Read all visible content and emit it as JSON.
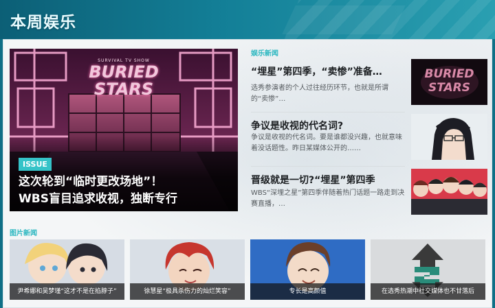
{
  "header": {
    "title": "本周娱乐"
  },
  "feature": {
    "badge": "ISSUE",
    "headline_line1": "这次轮到“临时更改场地”！",
    "headline_line2": "WBS盲目追求收视，独断专行",
    "logo_line1": "BURIED",
    "logo_line2": "STARS",
    "logo_small": "SURVIVAL TV SHOW"
  },
  "sections": {
    "news": "娱乐新闻",
    "photos": "图片新闻"
  },
  "news": [
    {
      "title": "“埋星”第四季，“卖惨”准备…",
      "desc": "选秀参演者的个人过往经历环节，也就是所谓的“卖惨”…",
      "thumb_logo1": "BURIED",
      "thumb_logo2": "STARS"
    },
    {
      "title": "争议是收视的代名词?",
      "desc": "争议是收视的代名词。要是谁都没兴趣，也就意味着没话题性。昨日某媒体公开的……"
    },
    {
      "title": "晋级就是一切?“埋星”第四季",
      "desc": "WBS“深埋之星”第四季伴随着热门话题一路走到决赛直播，…"
    }
  ],
  "photos": [
    {
      "caption": "尹希娜和吴梦瑾“这才不是在掐脖子”"
    },
    {
      "caption": "徐慧星“极具杀伤力的灿烂笑容”"
    },
    {
      "caption": "专长是高颜值"
    },
    {
      "caption": "在选秀热潮中社交媒体也不甘落后"
    }
  ],
  "colors": {
    "accent": "#2bb7c0",
    "header": "#137f97",
    "badge": "#35c3c8"
  }
}
